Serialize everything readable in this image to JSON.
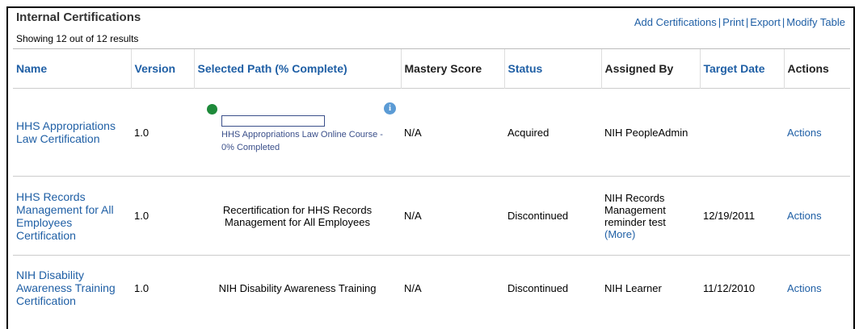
{
  "header": {
    "title": "Internal Certifications",
    "result_count": "Showing 12 out of 12 results",
    "links": [
      "Add Certifications",
      "Print",
      "Export",
      "Modify Table"
    ]
  },
  "columns": [
    "Name",
    "Version",
    "Selected Path (% Complete)",
    "Mastery Score",
    "Status",
    "Assigned By",
    "Target Date",
    "Actions"
  ],
  "rows": [
    {
      "name": "HHS Appropriations Law Certification",
      "version": "1.0",
      "path_label": "HHS Appropriations Law Online Course - 0% Completed",
      "path_progress": 0,
      "mastery": "N/A",
      "status": "Acquired",
      "assigned_by": "NIH PeopleAdmin",
      "target_date": "",
      "actions": "Actions"
    },
    {
      "name": "HHS Records Management for All Employees Certification",
      "version": "1.0",
      "path_text": "Recertification for HHS Records Management for All Employees",
      "mastery": "N/A",
      "status": "Discontinued",
      "assigned_by": "NIH Records Management reminder test",
      "assigned_more": "(More)",
      "target_date": "12/19/2011",
      "actions": "Actions"
    },
    {
      "name": "NIH Disability Awareness Training Certification",
      "version": "1.0",
      "path_text": "NIH Disability Awareness Training",
      "mastery": "N/A",
      "status": "Discontinued",
      "assigned_by": "NIH Learner",
      "target_date": "11/12/2010",
      "actions": "Actions"
    }
  ],
  "colors": {
    "link": "#1f5fa5",
    "progress": "#3a4f8a",
    "status_dot": "#1e8a3a",
    "info": "#5b9bd5"
  }
}
